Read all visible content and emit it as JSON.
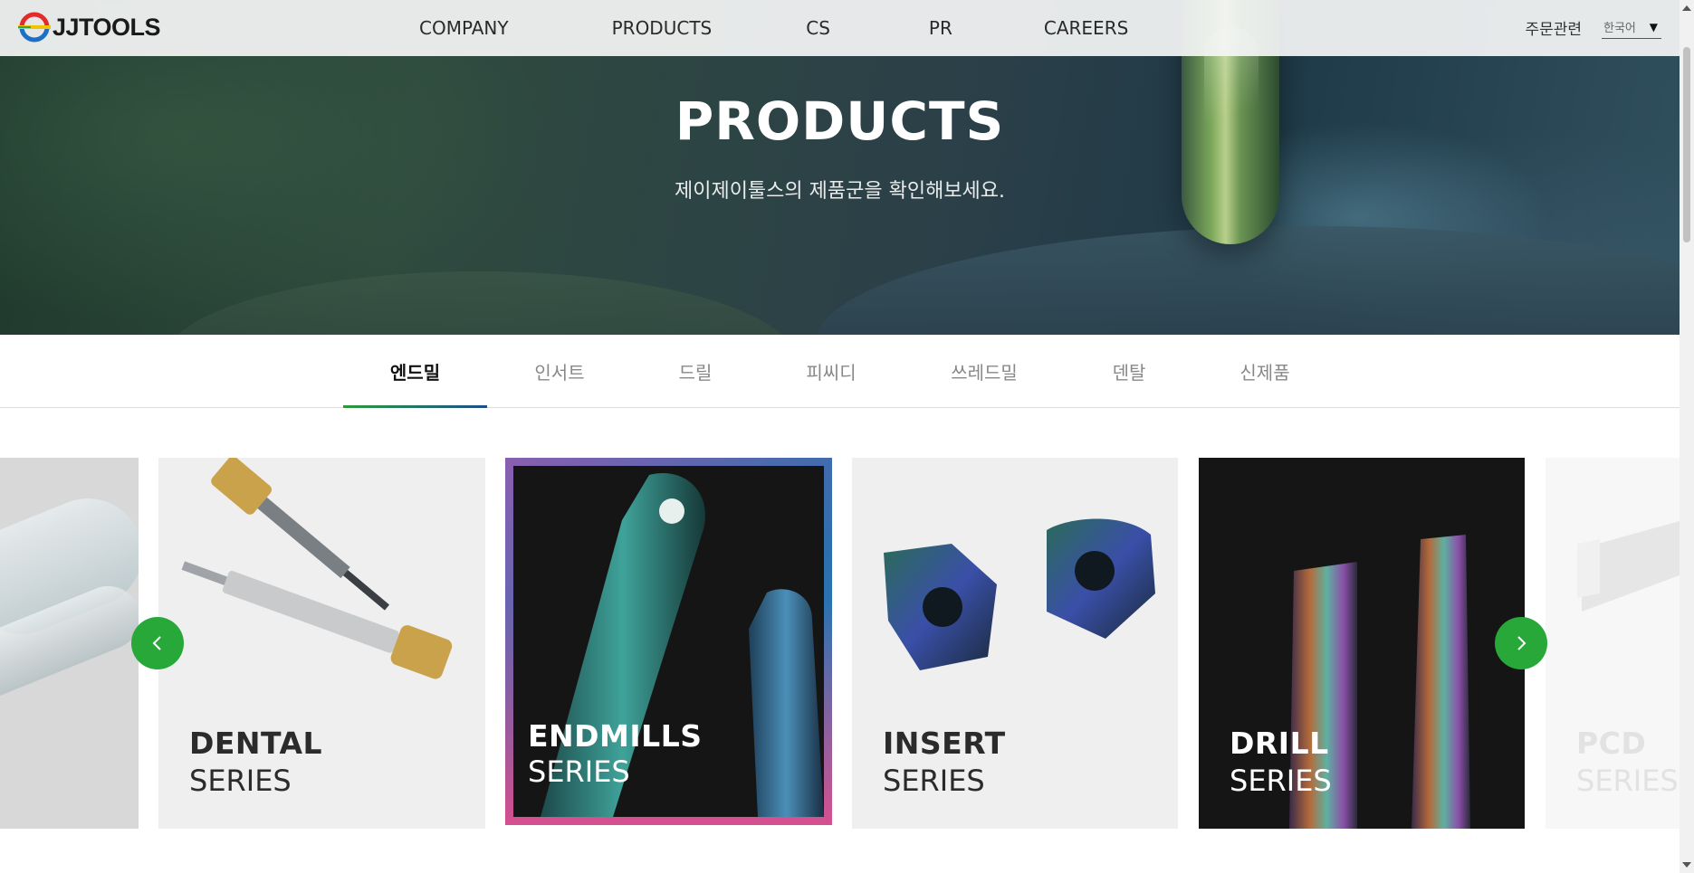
{
  "header": {
    "logo_text": "JJTOOLS",
    "nav": [
      "COMPANY",
      "PRODUCTS",
      "CS",
      "PR",
      "CAREERS"
    ],
    "order_label": "주문관련",
    "language": "한국어"
  },
  "hero": {
    "title": "PRODUCTS",
    "subtitle": "제이제이툴스의 제품군을 확인해보세요."
  },
  "tabs": [
    {
      "label": "엔드밀",
      "active": true
    },
    {
      "label": "인서트",
      "active": false
    },
    {
      "label": "드릴",
      "active": false
    },
    {
      "label": "피씨디",
      "active": false
    },
    {
      "label": "쓰레드밀",
      "active": false
    },
    {
      "label": "덴탈",
      "active": false
    },
    {
      "label": "신제품",
      "active": false
    }
  ],
  "cards": [
    {
      "name": "DENTAL",
      "sub": "SERIES"
    },
    {
      "name": "ENDMILLS",
      "sub": "SERIES"
    },
    {
      "name": "INSERT",
      "sub": "SERIES"
    },
    {
      "name": "DRILL",
      "sub": "SERIES"
    },
    {
      "name": "PCD",
      "sub": "SERIES"
    }
  ],
  "colors": {
    "accent_green": "#27a838",
    "tab_underline_start": "#2c9b3a",
    "tab_underline_end": "#1b4f8c",
    "logo_red": "#e32b2b",
    "logo_blue": "#1c6fc4"
  },
  "icons": {
    "prev": "chevron-left-icon",
    "next": "chevron-right-icon",
    "language_caret": "caret-down-icon"
  }
}
